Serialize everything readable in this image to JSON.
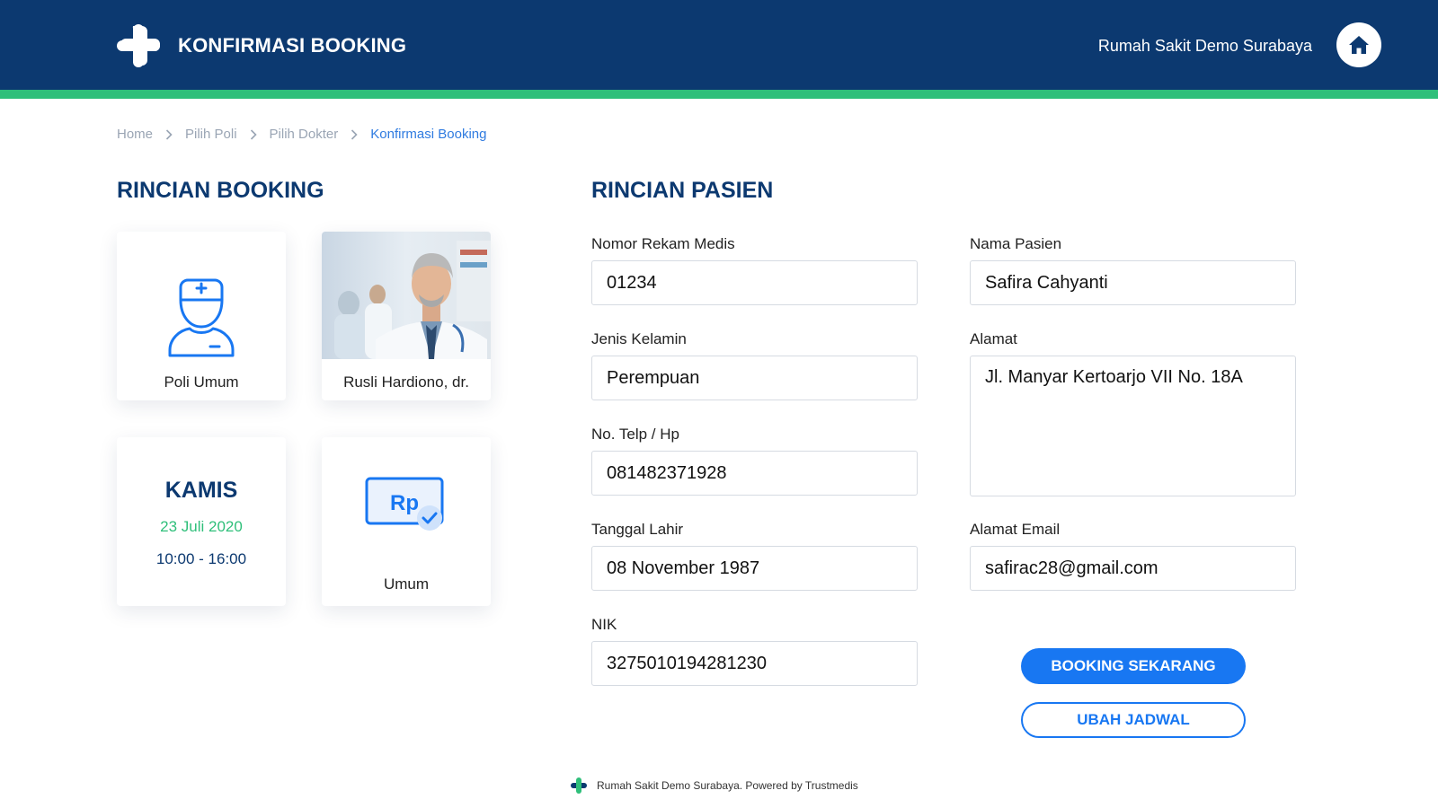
{
  "header": {
    "title": "KONFIRMASI BOOKING",
    "hospital_name": "Rumah Sakit Demo Surabaya",
    "bg_color": "#0c3970",
    "stripe_color": "#2fbf7a",
    "logo_icon": "medical-cross-logo",
    "home_icon": "home-icon"
  },
  "breadcrumb": {
    "items": [
      "Home",
      "Pilih Poli",
      "Pilih Dokter",
      "Konfirmasi Booking"
    ],
    "active_color": "#2f7be0"
  },
  "booking": {
    "title": "RINCIAN BOOKING",
    "poli": {
      "label": "Poli Umum",
      "icon": "nurse-icon"
    },
    "doctor": {
      "name": "Rusli Hardiono, dr.",
      "photo": "doctor-photo"
    },
    "schedule": {
      "day": "KAMIS",
      "date": "23 Juli 2020",
      "time": "10:00 - 16:00"
    },
    "payment": {
      "label": "Umum",
      "icon": "rupiah-payment-icon"
    }
  },
  "patient": {
    "title": "RINCIAN PASIEN",
    "fields": {
      "nomor_rekam_medis": {
        "label": "Nomor Rekam Medis",
        "value": "01234"
      },
      "nama_pasien": {
        "label": "Nama Pasien",
        "value": "Safira Cahyanti"
      },
      "jenis_kelamin": {
        "label": "Jenis Kelamin",
        "value": "Perempuan"
      },
      "alamat": {
        "label": "Alamat",
        "value": "Jl. Manyar Kertoarjo VII No. 18A"
      },
      "telp": {
        "label": "No. Telp / Hp",
        "value": "081482371928"
      },
      "tanggal_lahir": {
        "label": "Tanggal Lahir",
        "value": "08 November 1987"
      },
      "email": {
        "label": "Alamat Email",
        "value": "safirac28@gmail.com"
      },
      "nik": {
        "label": "NIK",
        "value": "3275010194281230"
      }
    }
  },
  "actions": {
    "booking_now": "BOOKING SEKARANG",
    "change_schedule": "UBAH JADWAL",
    "accent_color": "#1877f2"
  },
  "footer": {
    "text": "Rumah Sakit Demo Surabaya. Powered by Trustmedis"
  }
}
